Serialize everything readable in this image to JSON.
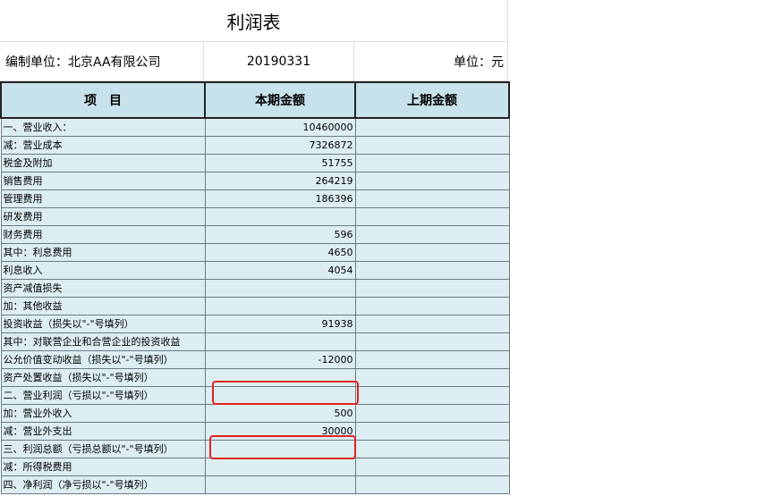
{
  "title": "利润表",
  "meta": {
    "company": "编制单位：北京AA有限公司",
    "date": "20190331",
    "unit": "单位：元"
  },
  "headers": [
    "项　目",
    "本期金额",
    "上期金额"
  ],
  "rows": [
    {
      "name": "一、营业收入：",
      "current": "10460000",
      "previous": ""
    },
    {
      "name": "减：营业成本",
      "current": "7326872",
      "previous": ""
    },
    {
      "name": "税金及附加",
      "current": "51755",
      "previous": ""
    },
    {
      "name": "销售费用",
      "current": "264219",
      "previous": ""
    },
    {
      "name": "管理费用",
      "current": "186396",
      "previous": ""
    },
    {
      "name": "研发费用",
      "current": "",
      "previous": ""
    },
    {
      "name": "财务费用",
      "current": "596",
      "previous": ""
    },
    {
      "name": "其中：利息费用",
      "current": "4650",
      "previous": ""
    },
    {
      "name": "利息收入",
      "current": "4054",
      "previous": ""
    },
    {
      "name": "资产减值损失",
      "current": "",
      "previous": ""
    },
    {
      "name": "加：其他收益",
      "current": "",
      "previous": ""
    },
    {
      "name": "投资收益（损失以\"-\"号填列）",
      "current": "91938",
      "previous": ""
    },
    {
      "name": "其中：对联营企业和合营企业的投资收益",
      "current": "",
      "previous": ""
    },
    {
      "name": "公允价值变动收益（损失以\"-\"号填列）",
      "current": "-12000",
      "previous": ""
    },
    {
      "name": "资产处置收益（损失以\"-\"号填列）",
      "current": "",
      "previous": ""
    },
    {
      "name": "二、营业利润（亏损以\"-\"号填列）",
      "current": "",
      "previous": ""
    },
    {
      "name": "加：营业外收入",
      "current": "500",
      "previous": ""
    },
    {
      "name": "减：营业外支出",
      "current": "30000",
      "previous": ""
    },
    {
      "name": "三、利润总额（亏损总额以\"-\"号填列）",
      "current": "",
      "previous": ""
    },
    {
      "name": "减：所得税费用",
      "current": "",
      "previous": ""
    },
    {
      "name": "四、净利润（净亏损以\"-\"号填列）",
      "current": "",
      "previous": ""
    }
  ],
  "colors": {
    "header_bg": "#c7e2ea",
    "row_bg": "#ddeef3",
    "highlight": "#e02222"
  }
}
